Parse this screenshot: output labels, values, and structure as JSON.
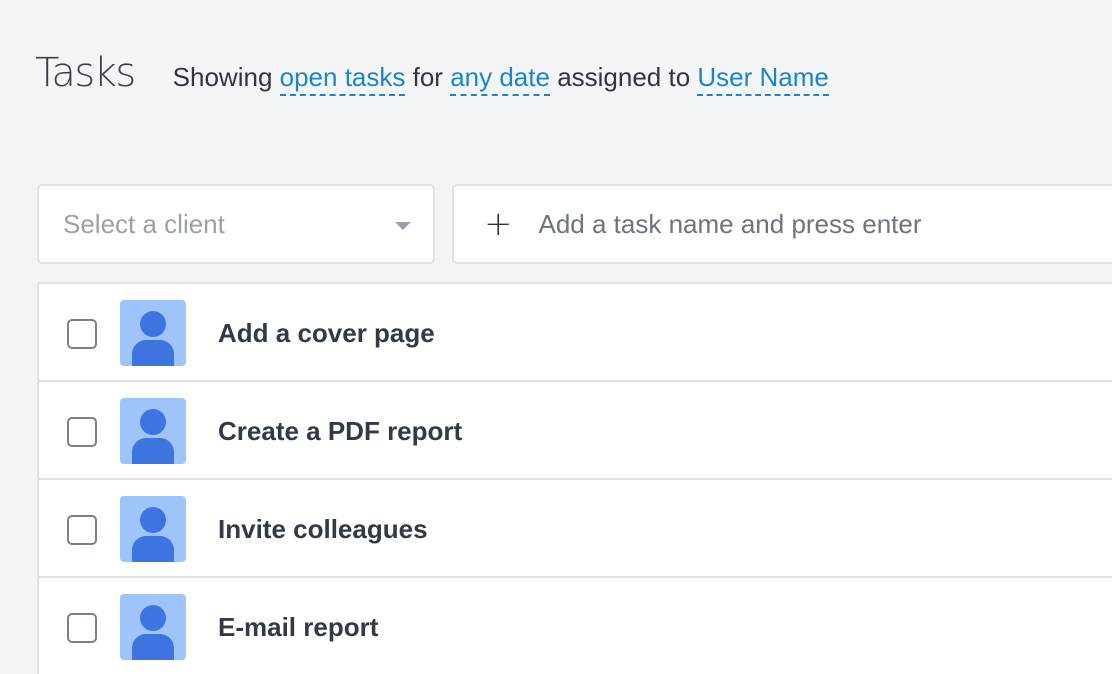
{
  "header": {
    "title": "Tasks",
    "filter": {
      "prefix": "Showing",
      "status_link": "open tasks",
      "mid1": "for",
      "date_link": "any date",
      "mid2": "assigned to",
      "user_link": "User Name"
    }
  },
  "toolbar": {
    "client_select": {
      "placeholder": "Select a client",
      "icon": "chevron-down-icon"
    },
    "task_entry": {
      "icon": "plus-icon",
      "plus_glyph": "+",
      "placeholder": "Add a task name and press enter",
      "value": ""
    }
  },
  "tasks": [
    {
      "name": "Add a cover page",
      "checked": false,
      "avatar": "user-avatar-icon"
    },
    {
      "name": "Create a PDF report",
      "checked": false,
      "avatar": "user-avatar-icon"
    },
    {
      "name": "Invite colleagues",
      "checked": false,
      "avatar": "user-avatar-icon"
    },
    {
      "name": "E-mail report",
      "checked": false,
      "avatar": "user-avatar-icon"
    }
  ],
  "colors": {
    "background": "#f4f5f7",
    "link": "#1a86c7",
    "avatar_bg": "#9ec4fa",
    "avatar_fg": "#3e74e0",
    "border": "#dfe1e6"
  }
}
